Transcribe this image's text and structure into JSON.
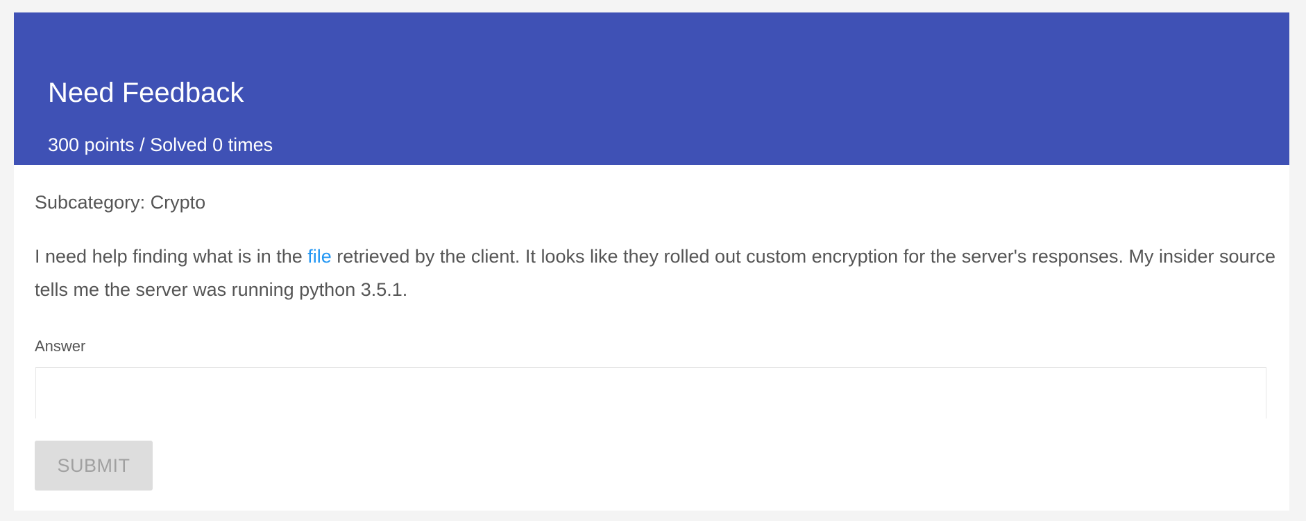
{
  "challenge": {
    "title": "Need Feedback",
    "subtitle": "300 points / Solved 0 times",
    "subcategory": "Subcategory: Crypto",
    "description": {
      "before_link": "I need help finding what is in the ",
      "link_text": "file",
      "after_link": " retrieved by the client. It looks like they rolled out custom encryption for the server's responses. My insider source tells me the server was running python 3.5.1."
    }
  },
  "answer_form": {
    "label": "Answer",
    "value": "",
    "placeholder": "",
    "submit_label": "SUBMIT"
  },
  "colors": {
    "header_background": "#3f51b5",
    "link": "#2196f3",
    "page_background": "#f4f4f4",
    "button_disabled_background": "#dddddd",
    "button_disabled_text": "#a0a0a0"
  }
}
